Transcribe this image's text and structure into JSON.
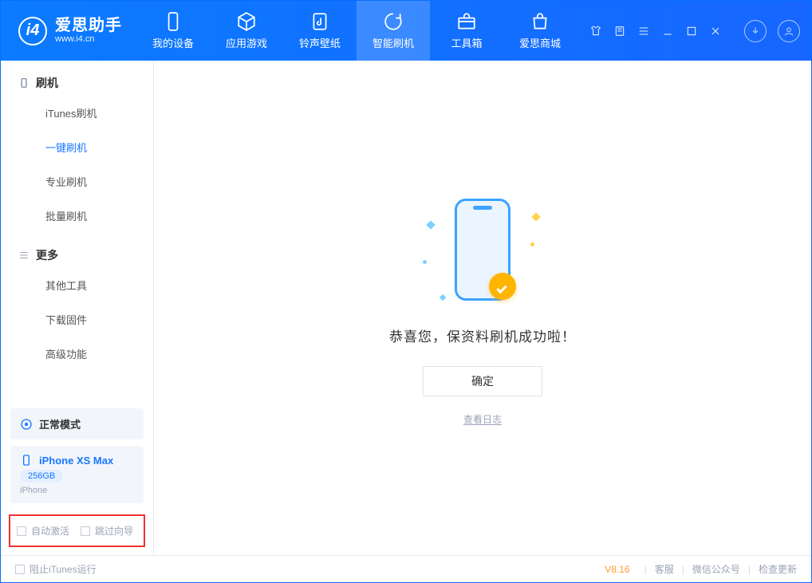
{
  "brand": {
    "name": "爱思助手",
    "sub": "www.i4.cn"
  },
  "tabs": {
    "device": "我的设备",
    "apps": "应用游戏",
    "rings": "铃声壁纸",
    "flash": "智能刷机",
    "toolbox": "工具箱",
    "store": "爱思商城"
  },
  "sidebar": {
    "group_flash": "刷机",
    "items_flash": [
      "iTunes刷机",
      "一键刷机",
      "专业刷机",
      "批量刷机"
    ],
    "group_more": "更多",
    "items_more": [
      "其他工具",
      "下载固件",
      "高级功能"
    ]
  },
  "mode_card": {
    "label": "正常模式"
  },
  "device_card": {
    "name": "iPhone XS Max",
    "storage": "256GB",
    "type": "iPhone"
  },
  "options": {
    "auto_activate": "自动激活",
    "skip_guide": "跳过向导"
  },
  "main": {
    "success_msg": "恭喜您，保资料刷机成功啦！",
    "ok": "确定",
    "view_log": "查看日志"
  },
  "footer": {
    "block_itunes": "阻止iTunes运行",
    "version": "V8.16",
    "support": "客服",
    "wechat": "微信公众号",
    "update": "检查更新"
  }
}
